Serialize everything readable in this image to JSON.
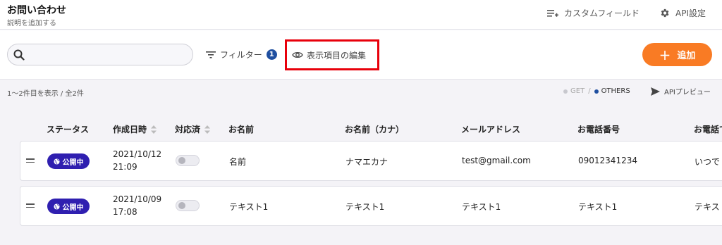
{
  "header": {
    "title": "お問い合わせ",
    "description": "説明を追加する",
    "custom_field_label": "カスタムフィールド",
    "api_settings_label": "API設定"
  },
  "toolbar": {
    "search_value": "",
    "search_placeholder": "",
    "filter_label": "フィルター",
    "filter_count": "1",
    "edit_columns_label": "表示項目の編集",
    "add_label": "追加"
  },
  "info": {
    "count_text": "1〜2件目を表示 / 全2件",
    "get_label": "GET",
    "separator": "/",
    "others_label": "OTHERS",
    "api_preview_label": "APIプレビュー"
  },
  "table": {
    "columns": [
      "ステータス",
      "作成日時",
      "対応済",
      "お名前",
      "お名前（カナ）",
      "メールアドレス",
      "お電話番号",
      "お電話で"
    ],
    "rows": [
      {
        "status": "公開中",
        "date": "2021/10/12",
        "time": "21:09",
        "handled": false,
        "name": "名前",
        "kana": "ナマエカナ",
        "email": "test@gmail.com",
        "phone": "09012341234",
        "phone_time": "いつで"
      },
      {
        "status": "公開中",
        "date": "2021/10/09",
        "time": "17:08",
        "handled": false,
        "name": "テキスト1",
        "kana": "テキスト1",
        "email": "テキスト1",
        "phone": "テキスト1",
        "phone_time": "テキス"
      }
    ]
  },
  "colors": {
    "accent": "#f97b24",
    "badge": "#2f1fb0",
    "filter_badge": "#1f4fa0",
    "highlight_border": "#e8000b"
  }
}
